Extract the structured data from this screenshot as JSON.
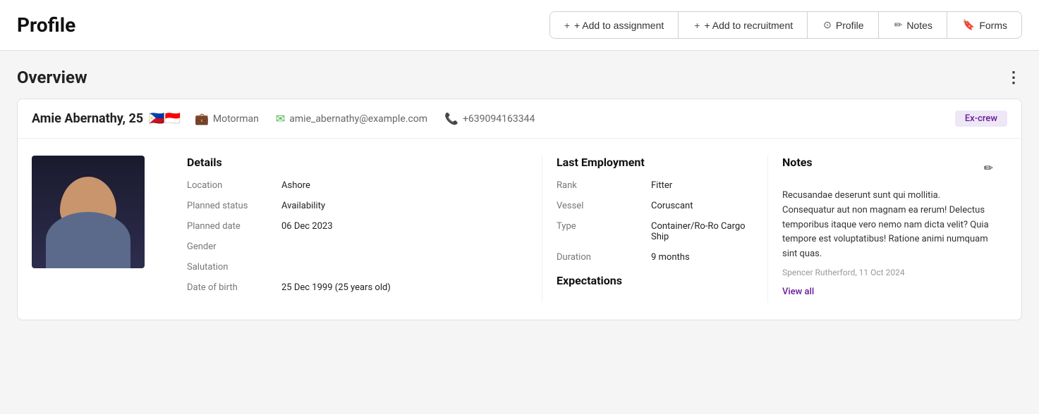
{
  "header": {
    "page_title": "Profile",
    "toolbar": {
      "add_assignment": "+ Add to assignment",
      "add_recruitment": "+ Add to recruitment",
      "profile": "Profile",
      "notes": "Notes",
      "forms": "Forms"
    }
  },
  "overview": {
    "title": "Overview",
    "more_icon": "⋮"
  },
  "person": {
    "name": "Amie Abernathy, 25",
    "flags": "🇵🇭🇮🇩",
    "role": "Motorman",
    "email": "amie_abernathy@example.com",
    "phone": "+639094163344",
    "status_badge": "Ex-crew"
  },
  "details": {
    "heading": "Details",
    "location_label": "Location",
    "location_value": "Ashore",
    "planned_status_label": "Planned status",
    "planned_status_value": "Availability",
    "planned_date_label": "Planned date",
    "planned_date_value": "06 Dec 2023",
    "gender_label": "Gender",
    "gender_value": "",
    "salutation_label": "Salutation",
    "salutation_value": "",
    "dob_label": "Date of birth",
    "dob_value": "25 Dec 1999 (25 years old)"
  },
  "last_employment": {
    "heading": "Last Employment",
    "rank_label": "Rank",
    "rank_value": "Fitter",
    "vessel_label": "Vessel",
    "vessel_value": "Coruscant",
    "type_label": "Type",
    "type_value": "Container/Ro-Ro Cargo Ship",
    "duration_label": "Duration",
    "duration_value": "9 months",
    "expectations_heading": "Expectations"
  },
  "notes": {
    "heading": "Notes",
    "text": "Recusandae deserunt sunt qui mollitia. Consequatur aut non magnam ea rerum! Delectus temporibus itaque vero nemo nam dicta velit? Quia tempore est voluptatibus! Ratione animi numquam sint quas.",
    "author": "Spencer Rutherford, 11 Oct 2024",
    "view_all": "View all"
  }
}
